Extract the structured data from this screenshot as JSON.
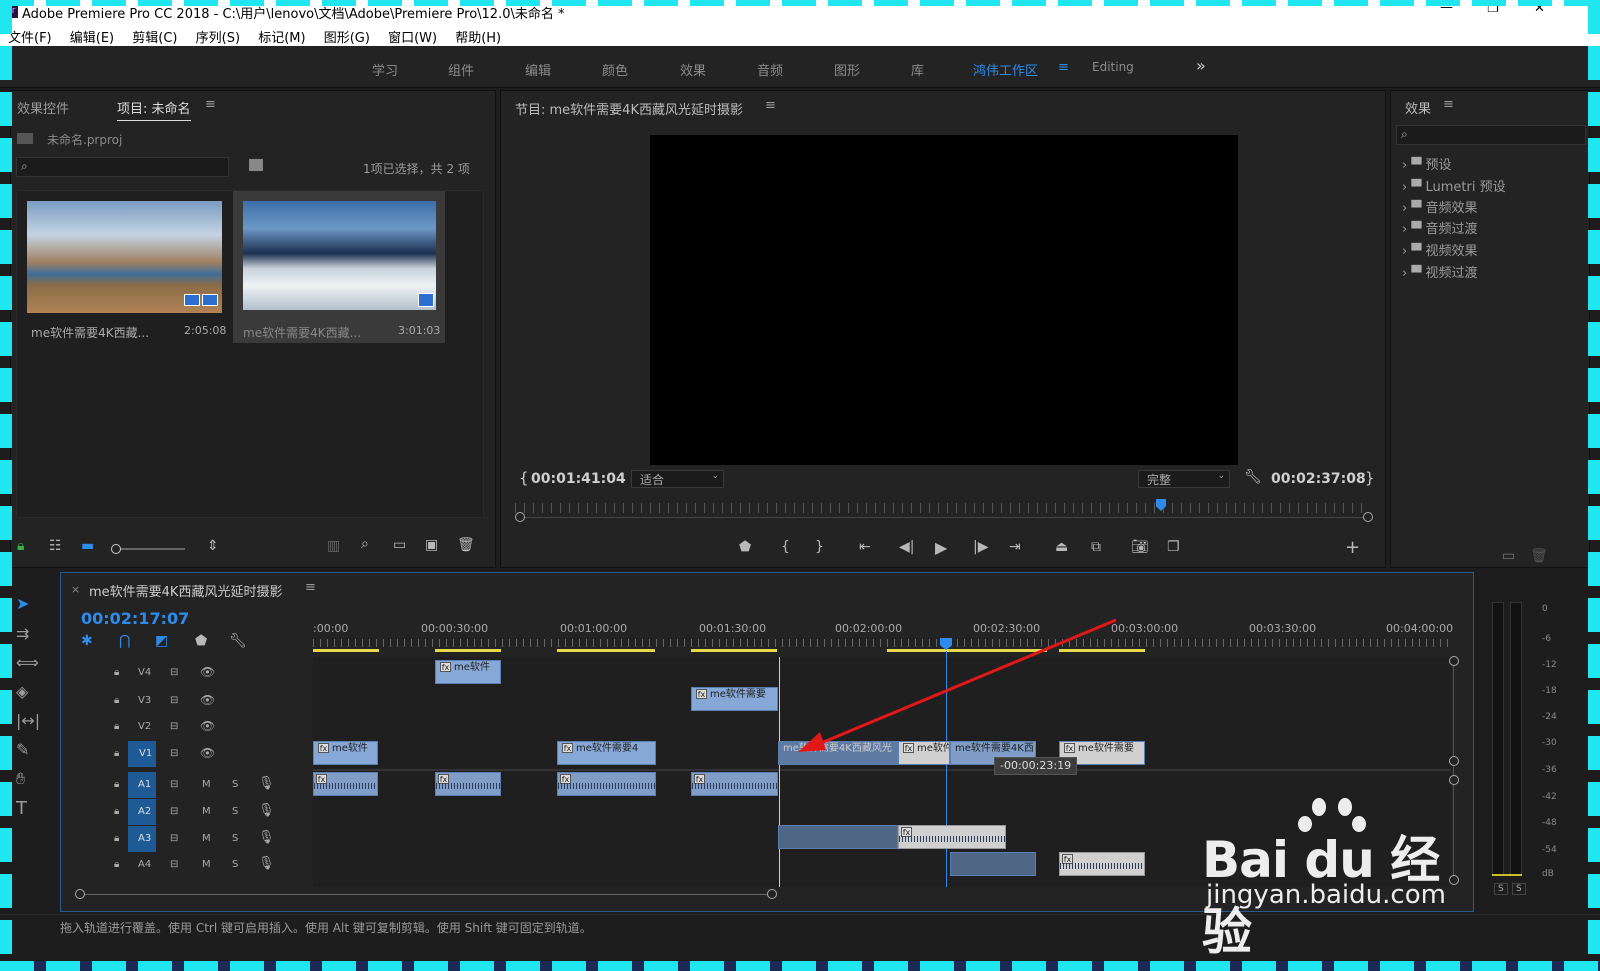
{
  "window": {
    "title": "Adobe Premiere Pro CC 2018 - C:\\用户\\lenovo\\文档\\Adobe\\Premiere Pro\\12.0\\未命名 *"
  },
  "menu": [
    "文件(F)",
    "编辑(E)",
    "剪辑(C)",
    "序列(S)",
    "标记(M)",
    "图形(G)",
    "窗口(W)",
    "帮助(H)"
  ],
  "workspaces": [
    "学习",
    "组件",
    "编辑",
    "颜色",
    "效果",
    "音频",
    "图形",
    "库",
    "鸿伟工作区",
    "Editing"
  ],
  "workspace_more": "»",
  "project_panel": {
    "tab_effects_controls": "效果控件",
    "tab_project": "项目: 未命名",
    "project_file": "未命名.prproj",
    "selection_count": "1项已选择，共 2 项",
    "items": [
      {
        "name": "me软件需要4K西藏...",
        "duration": "2:05:08"
      },
      {
        "name": "me软件需要4K西藏...",
        "duration": "3:01:03"
      }
    ]
  },
  "program_monitor": {
    "title": "节目: me软件需要4K西藏风光延时摄影",
    "timecode_in": "00:01:41:04",
    "fit": "适合",
    "quality": "完整",
    "duration": "00:02:37:08"
  },
  "effects_panel": {
    "title": "效果",
    "items": [
      "预设",
      "Lumetri 预设",
      "音频效果",
      "音频过渡",
      "视频效果",
      "视频过渡"
    ]
  },
  "timeline": {
    "sequence_name": "me软件需要4K西藏风光延时摄影",
    "timecode": "00:02:17:07",
    "ruler": [
      ":00:00",
      "00:00:30:00",
      "00:01:00:00",
      "00:01:30:00",
      "00:02:00:00",
      "00:02:30:00",
      "00:03:00:00",
      "00:03:30:00",
      "00:04:00:00"
    ],
    "tracks": [
      "V4",
      "V3",
      "V2",
      "V1",
      "A1",
      "A2",
      "A3",
      "A4"
    ],
    "clip_label": "me软件需要4K西藏风光",
    "clip_short": "me软件",
    "clip_mid": "me软件需要",
    "clip_mid2": "me软件需要4",
    "clip_v1c": "me软件",
    "clip_v1d": "me软件需要4K西",
    "clip_v1e": "me软件需要",
    "clip_v3": "me软件需要",
    "tooltip": "-00:00:23:19",
    "track_m": "M",
    "track_s": "S"
  },
  "meter_labels": [
    "0",
    "-6",
    "-12",
    "-18",
    "-24",
    "-30",
    "-36",
    "-42",
    "-48",
    "-54",
    "dB"
  ],
  "meter_solo": "S",
  "status_bar": "拖入轨道进行覆盖。使用 Ctrl 键可启用插入。使用 Alt 键可复制剪辑。使用 Shift 键可固定到轨道。",
  "watermark": {
    "brand": "Bai du 经验",
    "url": "jingyan.baidu.com"
  },
  "colors": {
    "accent": "#2d8ceb",
    "clip_video": "#86a8d6",
    "clip_selected": "#d0d0d0",
    "arrow": "#e01818"
  }
}
